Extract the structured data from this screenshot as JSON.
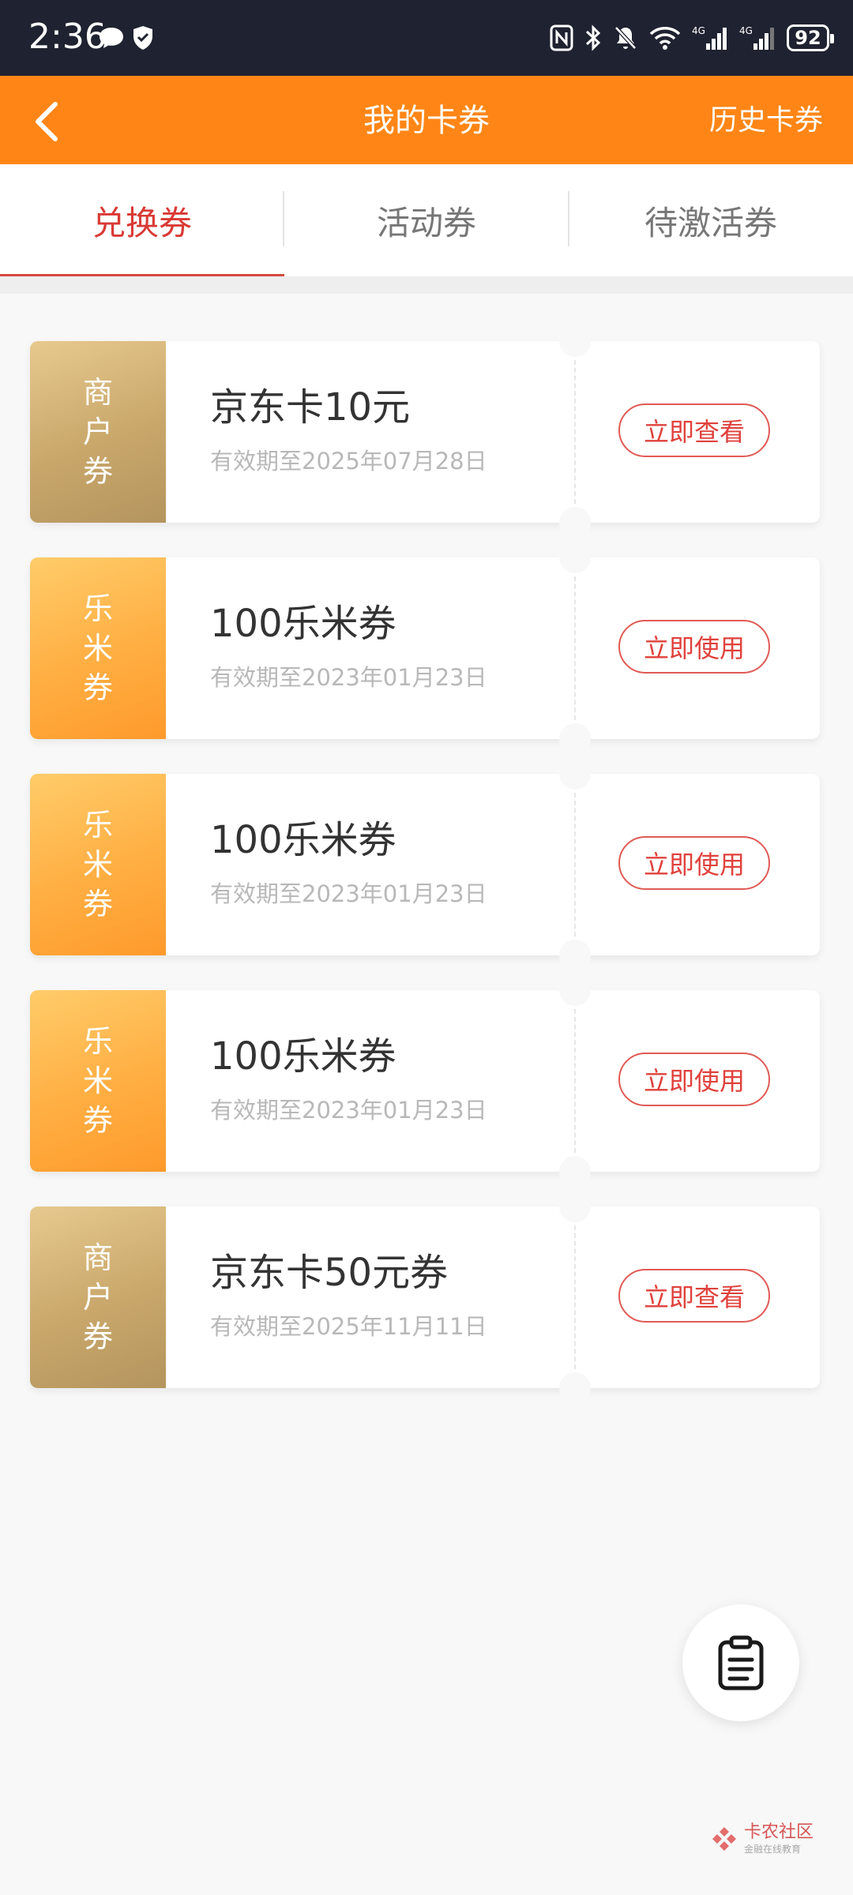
{
  "status_bar": {
    "time": "2:36",
    "battery": "92"
  },
  "header": {
    "title": "我的卡券",
    "history_label": "历史卡券"
  },
  "tabs": [
    {
      "label": "兑换券",
      "active": true
    },
    {
      "label": "活动券",
      "active": false
    },
    {
      "label": "待激活券",
      "active": false
    }
  ],
  "coupons": [
    {
      "tag": [
        "商",
        "户",
        "券"
      ],
      "tag_type": "merchant",
      "name": "京东卡10元",
      "date": "有效期至2025年07月28日",
      "action": "立即查看"
    },
    {
      "tag": [
        "乐",
        "米",
        "券"
      ],
      "tag_type": "lemi",
      "name": "100乐米券",
      "date": "有效期至2023年01月23日",
      "action": "立即使用"
    },
    {
      "tag": [
        "乐",
        "米",
        "券"
      ],
      "tag_type": "lemi",
      "name": "100乐米券",
      "date": "有效期至2023年01月23日",
      "action": "立即使用"
    },
    {
      "tag": [
        "乐",
        "米",
        "券"
      ],
      "tag_type": "lemi",
      "name": "100乐米券",
      "date": "有效期至2023年01月23日",
      "action": "立即使用"
    },
    {
      "tag": [
        "商",
        "户",
        "券"
      ],
      "tag_type": "merchant",
      "name": "京东卡50元券",
      "date": "有效期至2025年11月11日",
      "action": "立即查看"
    }
  ],
  "watermark": {
    "title": "卡农社区",
    "subtitle": "金融在线教育"
  },
  "colors": {
    "header": "#ff8616",
    "accent_red": "#d93a35",
    "merchant_tag": "#c9a76b",
    "lemi_tag": "#ffae42"
  },
  "icons": {
    "back": "chevron-left-icon",
    "fab": "clipboard-icon"
  }
}
